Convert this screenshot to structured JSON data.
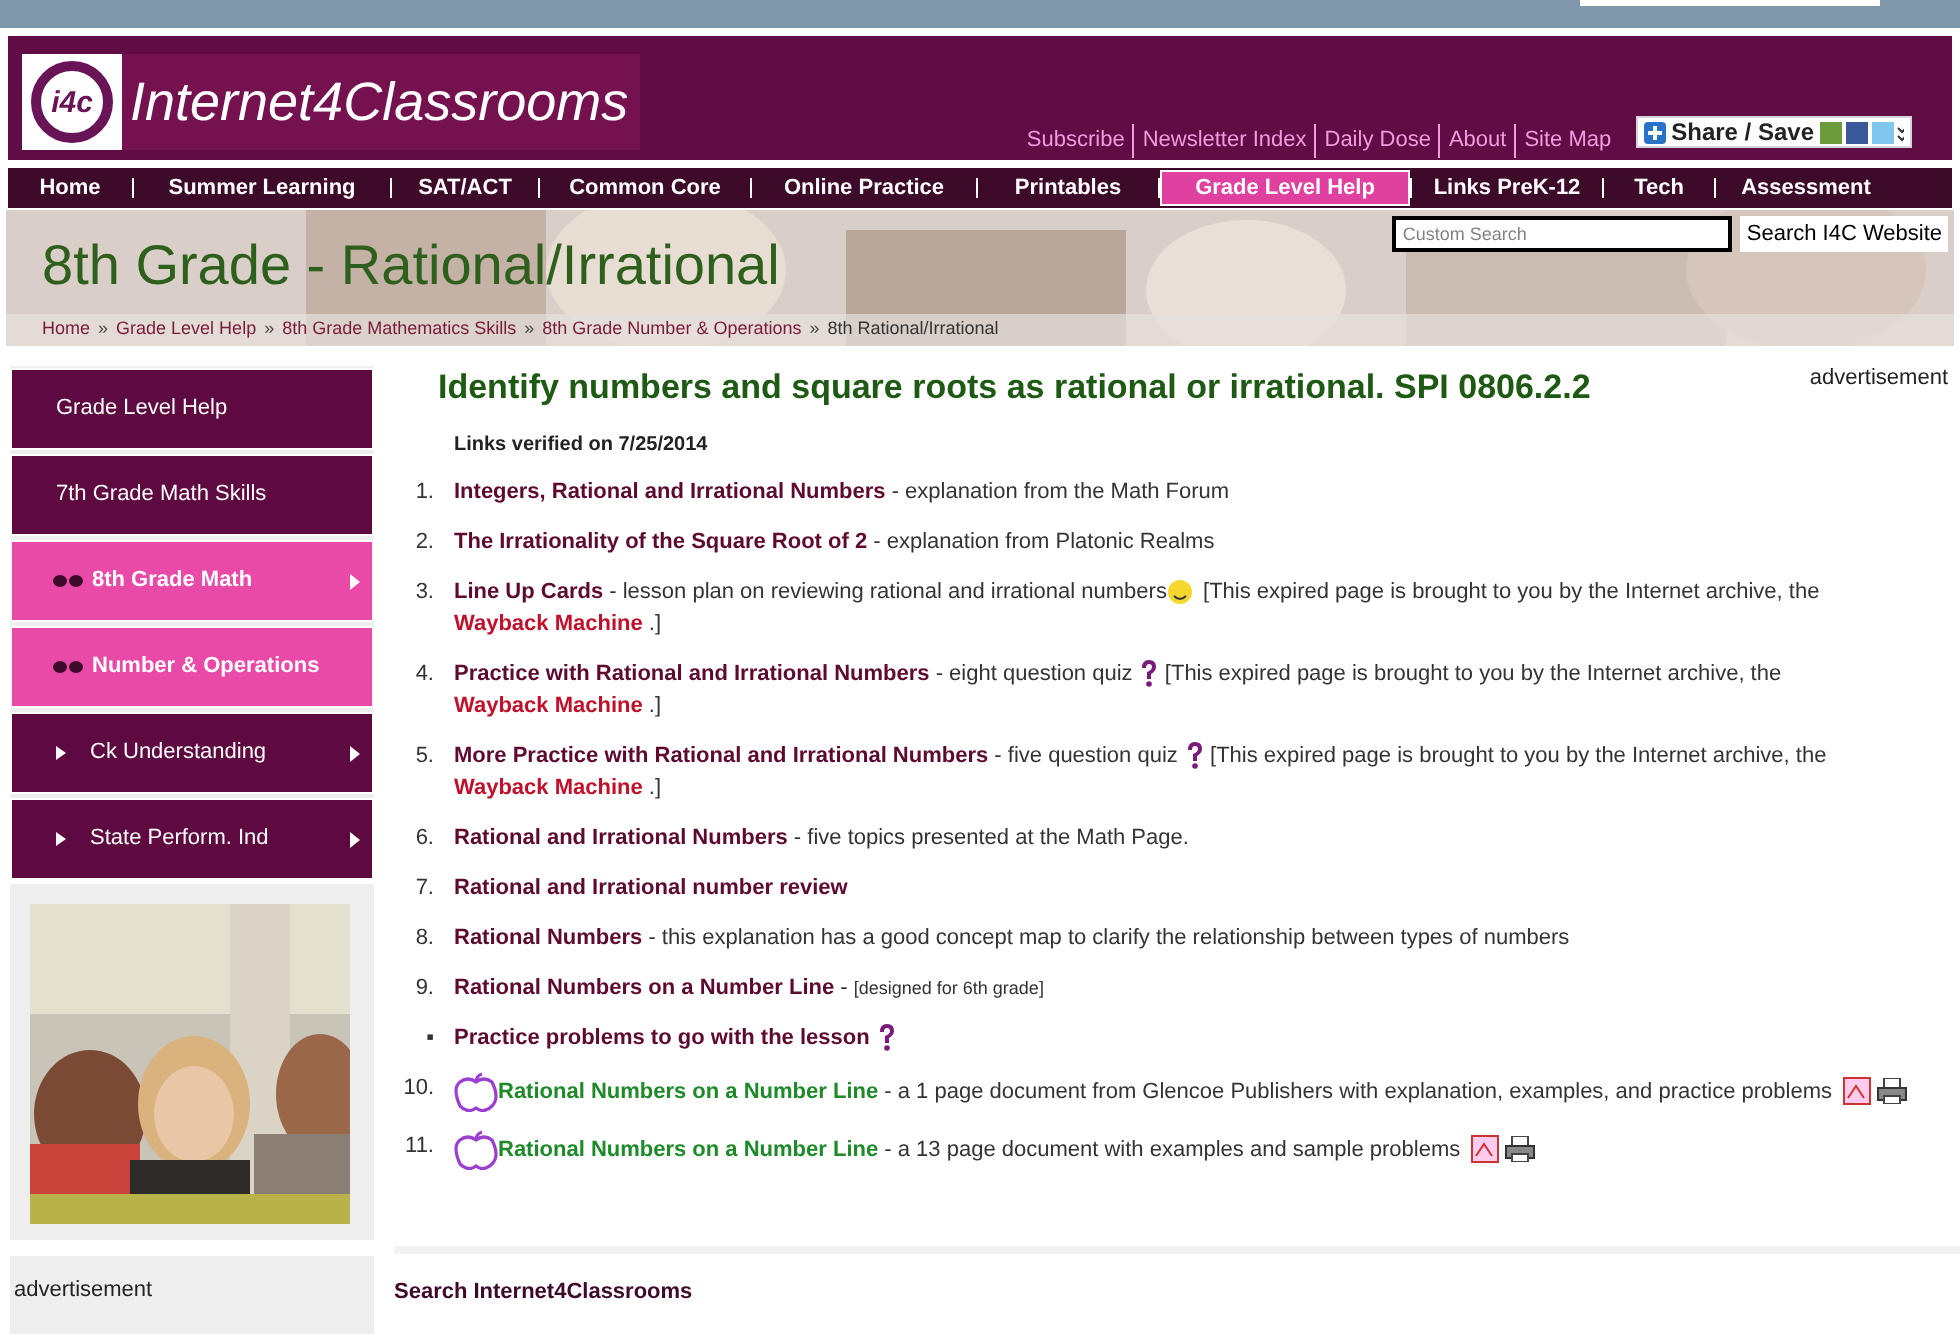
{
  "header": {
    "logo_mark": "i4c",
    "site_name": "Internet4Classrooms",
    "top_links": [
      "Subscribe",
      "Newsletter Index",
      "Daily Dose",
      "About",
      "Site Map"
    ],
    "share_button": "Share / Save"
  },
  "nav": [
    {
      "label": "Home",
      "selected": false
    },
    {
      "label": "Summer Learning",
      "selected": false
    },
    {
      "label": "SAT/ACT",
      "selected": false
    },
    {
      "label": "Common Core",
      "selected": false
    },
    {
      "label": "Online Practice",
      "selected": false
    },
    {
      "label": "Printables",
      "selected": false
    },
    {
      "label": "Grade Level Help",
      "selected": true
    },
    {
      "label": "Links PreK-12",
      "selected": false
    },
    {
      "label": "Tech",
      "selected": false
    },
    {
      "label": "Assessment",
      "selected": false
    }
  ],
  "banner": {
    "title": "8th Grade - Rational/Irrational",
    "search": {
      "placeholder": "Custom Search",
      "button": "Search I4C Website"
    },
    "breadcrumb_separator": "»",
    "breadcrumbs": [
      "Home",
      "Grade Level Help",
      "8th Grade Mathematics Skills",
      "8th Grade Number & Operations",
      "8th Rational/Irrational"
    ]
  },
  "sidebar": {
    "items": [
      {
        "label": "Grade Level Help",
        "selected": false,
        "expandable": false
      },
      {
        "label": "7th Grade Math Skills",
        "selected": false,
        "expandable": false
      },
      {
        "label": "8th Grade Math",
        "selected": true,
        "expandable": true
      },
      {
        "label": "Number & Operations",
        "selected": true,
        "expandable": false
      },
      {
        "label": "Ck Understanding",
        "selected": false,
        "expandable": true
      },
      {
        "label": "State Perform. Ind",
        "selected": false,
        "expandable": true
      }
    ],
    "ad_label": "advertisement"
  },
  "content": {
    "heading": "Identify numbers and square roots as rational or irrational. SPI 0806.2.2",
    "ad_label": "advertisement",
    "verified": "Links verified on 7/25/2014",
    "items": [
      {
        "marker": "1.",
        "title": "Integers, Rational and Irrational Numbers",
        "kind": "link",
        "desc": " - explanation from the Math Forum"
      },
      {
        "marker": "2.",
        "title": "The Irrationality of the Square Root of 2",
        "kind": "link",
        "desc": " - explanation from Platonic Realms"
      },
      {
        "marker": "3.",
        "title": "Line Up Cards",
        "kind": "lesson",
        "desc": " - lesson plan on reviewing rational and irrational numbers",
        "note": "[This expired page is brought to you by the Internet archive, the",
        "note_link": "Wayback Machine",
        "note_end": ".]"
      },
      {
        "marker": "4.",
        "title": "Practice with Rational and Irrational Numbers",
        "kind": "quiz",
        "desc": " - eight question quiz",
        "note": "[This expired page is brought to you by the Internet archive, the",
        "note_link": "Wayback Machine",
        "note_end": ".]"
      },
      {
        "marker": "5.",
        "title": "More Practice with Rational and Irrational Numbers",
        "kind": "quiz",
        "desc": " - five question quiz",
        "note": "[This expired page is brought to you by the Internet archive, the",
        "note_link": "Wayback Machine",
        "note_end": ".]"
      },
      {
        "marker": "6.",
        "title": "Rational and Irrational Numbers",
        "kind": "link",
        "desc": " - five topics presented at the Math Page."
      },
      {
        "marker": "7.",
        "title": "Rational and Irrational number review",
        "kind": "link"
      },
      {
        "marker": "8.",
        "title": "Rational Numbers",
        "kind": "link",
        "desc": " - this explanation has a good concept map to clarify the relationship between types of numbers"
      },
      {
        "marker": "9.",
        "title": "Rational Numbers on a Number Line",
        "kind": "link",
        "desc": " - ",
        "small": "[designed for 6th grade]"
      },
      {
        "marker": "▪",
        "title": "Practice problems to go with the lesson",
        "kind": "quiz"
      },
      {
        "marker": "10.",
        "title": "Rational Numbers on a Number Line",
        "kind": "document",
        "desc": " - a 1 page document from Glencoe Publishers with explanation, examples, and practice problems"
      },
      {
        "marker": "11.",
        "title": "Rational Numbers on a Number Line",
        "kind": "document",
        "desc": " - a 13 page document with examples and sample problems"
      }
    ],
    "search_heading": "Search Internet4Classrooms"
  }
}
